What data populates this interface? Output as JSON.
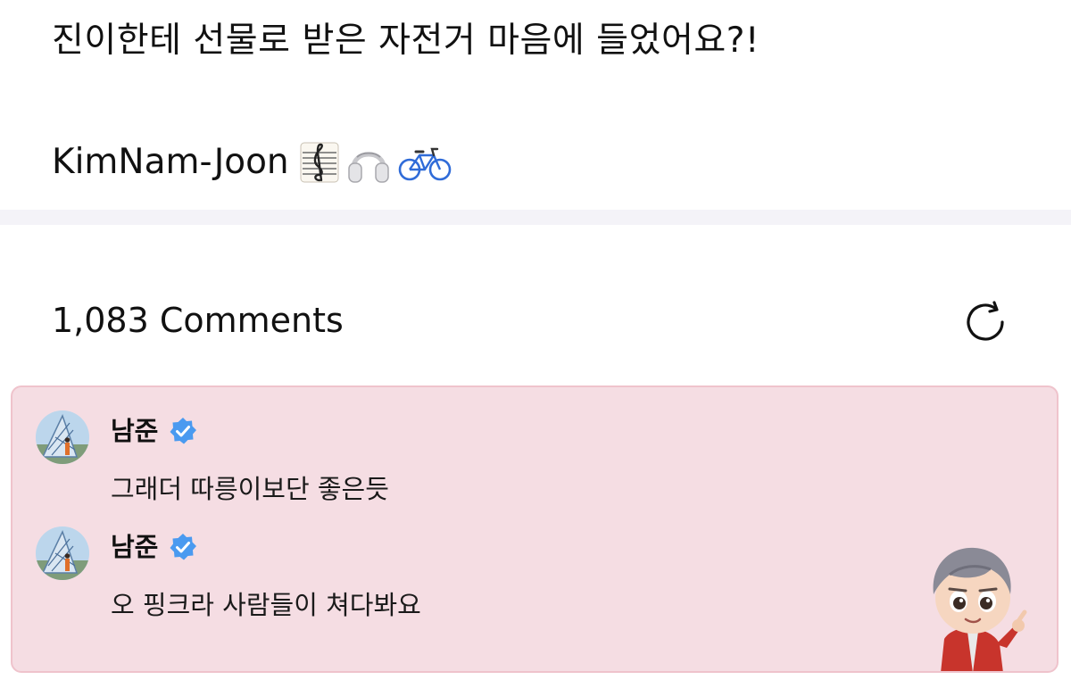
{
  "post": {
    "question": "진이한테 선물로 받은 자전거 마음에 들었어요?!",
    "signature_name": "KimNam-Joon",
    "signature_emojis": [
      "music-score-icon",
      "headphones-icon",
      "bicycle-icon"
    ]
  },
  "comments_section": {
    "count_label": "1,083 Comments",
    "refresh_icon": "refresh-icon"
  },
  "highlighted_comments": [
    {
      "author": "남준",
      "verified": true,
      "text": "그래더 따릉이보단 좋은듯"
    },
    {
      "author": "남준",
      "verified": true,
      "text": "오 핑크라 사람들이 쳐다봐요"
    }
  ],
  "colors": {
    "highlight_background": "#f5dde3",
    "highlight_border": "#efc3cc",
    "verified_badge": "#4a9af0",
    "divider": "#f4f3f8"
  }
}
